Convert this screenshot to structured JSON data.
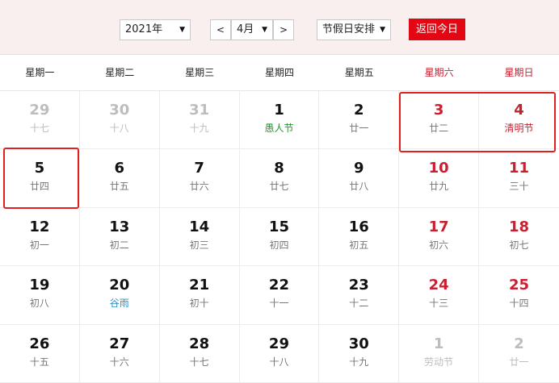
{
  "toolbar": {
    "year_value": "2021年",
    "prev_month_label": "<",
    "month_value": "4月",
    "next_month_label": ">",
    "holiday_value": "节假日安排",
    "today_button_label": "返回今日"
  },
  "weekdays": [
    "星期一",
    "星期二",
    "星期三",
    "星期四",
    "星期五",
    "星期六",
    "星期日"
  ],
  "weeks": [
    [
      {
        "day": "29",
        "lunar": "十七",
        "other": true
      },
      {
        "day": "30",
        "lunar": "十八",
        "other": true
      },
      {
        "day": "31",
        "lunar": "十九",
        "other": true
      },
      {
        "day": "1",
        "lunar": "愚人节",
        "style": "green"
      },
      {
        "day": "2",
        "lunar": "廿一"
      },
      {
        "day": "3",
        "lunar": "廿二"
      },
      {
        "day": "4",
        "lunar": "清明节",
        "style": "festival"
      }
    ],
    [
      {
        "day": "5",
        "lunar": "廿四"
      },
      {
        "day": "6",
        "lunar": "廿五"
      },
      {
        "day": "7",
        "lunar": "廿六"
      },
      {
        "day": "8",
        "lunar": "廿七"
      },
      {
        "day": "9",
        "lunar": "廿八"
      },
      {
        "day": "10",
        "lunar": "廿九"
      },
      {
        "day": "11",
        "lunar": "三十"
      }
    ],
    [
      {
        "day": "12",
        "lunar": "初一"
      },
      {
        "day": "13",
        "lunar": "初二"
      },
      {
        "day": "14",
        "lunar": "初三"
      },
      {
        "day": "15",
        "lunar": "初四"
      },
      {
        "day": "16",
        "lunar": "初五"
      },
      {
        "day": "17",
        "lunar": "初六"
      },
      {
        "day": "18",
        "lunar": "初七"
      }
    ],
    [
      {
        "day": "19",
        "lunar": "初八"
      },
      {
        "day": "20",
        "lunar": "谷雨",
        "style": "blue"
      },
      {
        "day": "21",
        "lunar": "初十"
      },
      {
        "day": "22",
        "lunar": "十一"
      },
      {
        "day": "23",
        "lunar": "十二"
      },
      {
        "day": "24",
        "lunar": "十三"
      },
      {
        "day": "25",
        "lunar": "十四"
      }
    ],
    [
      {
        "day": "26",
        "lunar": "十五"
      },
      {
        "day": "27",
        "lunar": "十六"
      },
      {
        "day": "28",
        "lunar": "十七"
      },
      {
        "day": "29",
        "lunar": "十八"
      },
      {
        "day": "30",
        "lunar": "十九"
      },
      {
        "day": "1",
        "lunar": "劳动节",
        "other": true
      },
      {
        "day": "2",
        "lunar": "廿一",
        "other": true
      }
    ]
  ],
  "colors": {
    "accent_red": "#e30613",
    "weekend_red": "#c8202f",
    "festival_green": "#1e9a28",
    "solar_term_blue": "#2a8ec7",
    "toolbar_bg": "#f9efef"
  }
}
